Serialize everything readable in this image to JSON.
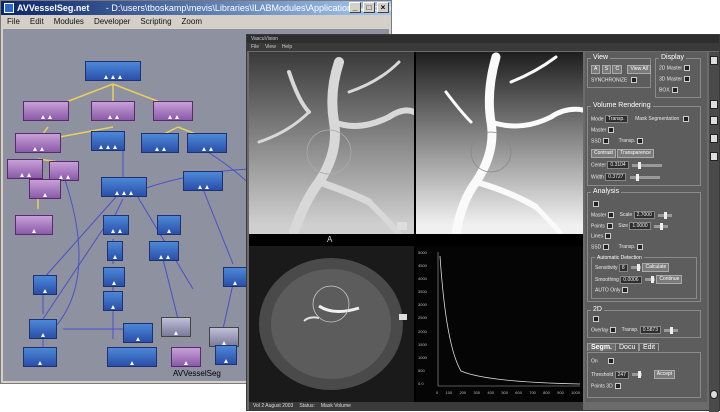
{
  "network_window": {
    "title_app": "AVVesselSeg.net",
    "title_path": "- D:\\users\\tboskamp\\mevis\\Libraries\\ILABModules\\Applications\\VascuVision",
    "menu": [
      "File",
      "Edit",
      "Modules",
      "Developer",
      "Scripting",
      "Zoom"
    ],
    "network_label": "AVVesselSeg"
  },
  "vascu_window": {
    "title": "VascuVision",
    "menu": [
      "File",
      "View",
      "Help"
    ],
    "viewport_label": "A",
    "status": {
      "date": "Vol 2 August 2003",
      "status_label": "Status:",
      "status_value": "Mask Volume"
    },
    "chart_axis": {
      "y_ticks": [
        "0.0",
        "500",
        "1000",
        "1500",
        "2000",
        "2500",
        "3000",
        "3500",
        "4000",
        "4500",
        "5000"
      ],
      "x_ticks": [
        "0",
        "100",
        "200",
        "300",
        "400",
        "500",
        "600",
        "700",
        "800",
        "900",
        "1000"
      ]
    },
    "panel": {
      "view": {
        "title": "View",
        "buttons": [
          "A",
          "S",
          "C"
        ],
        "view_all": "View All",
        "synchronize": "SYNCHRONIZE"
      },
      "display": {
        "title": "Display",
        "options": [
          "2D Master",
          "3D Master",
          "BOX"
        ]
      },
      "volume_rendering": {
        "title": "Volume Rendering",
        "mode_label": "Mode",
        "mode_value": "Transp.",
        "mask_seg": "Mask Segmentation",
        "rows": [
          "Master",
          "SSD"
        ],
        "transp_label": "Transp.",
        "tabs": [
          "Contrast",
          "Transparence"
        ],
        "center_label": "Center",
        "center_value": "0.3104",
        "width_label": "Width",
        "width_value": "0.3727"
      },
      "analysis": {
        "title": "Analysis",
        "master": "Master",
        "scale_label": "Scale",
        "scale_value": "2.7000",
        "points": "Points",
        "size_label": "Size",
        "size_value": "1.0000",
        "lines": "Lines",
        "ssd": "SSD",
        "transp": "Transp.",
        "detection_title": "Automatic Detection",
        "sensitivity_label": "Sensitivity",
        "sensitivity_value": "8",
        "calculate": "Calculate",
        "smoothing_label": "Smoothing",
        "smoothing_value": "0.0006",
        "continue": "Continue",
        "auto_only": "AUTO Only"
      },
      "twod": {
        "title": "2D",
        "overlay": "Overlay",
        "transp": "Transp.",
        "transp_value": "0.5873"
      },
      "tabs": [
        "Segm.",
        "Docu",
        "Edit"
      ],
      "segm": {
        "on": "On",
        "threshold_label": "Threshold",
        "threshold_value": "247",
        "accept": "Accept",
        "points_3d": "Points 3D"
      }
    }
  }
}
